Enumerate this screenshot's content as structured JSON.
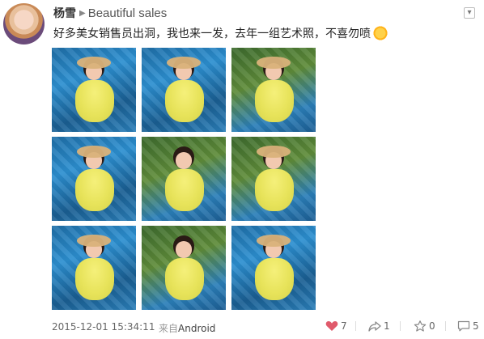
{
  "post": {
    "author": "杨雪",
    "group": "Beautiful sales",
    "text": "好多美女销售员出洞，我也来一发，去年一组艺术照，不喜勿喷",
    "emoji": "sun-icon"
  },
  "photos": [
    {
      "id": 1,
      "alt": "photo-1"
    },
    {
      "id": 2,
      "alt": "photo-2"
    },
    {
      "id": 3,
      "alt": "photo-3"
    },
    {
      "id": 4,
      "alt": "photo-4"
    },
    {
      "id": 5,
      "alt": "photo-5"
    },
    {
      "id": 6,
      "alt": "photo-6"
    },
    {
      "id": 7,
      "alt": "photo-7"
    },
    {
      "id": 8,
      "alt": "photo-8"
    },
    {
      "id": 9,
      "alt": "photo-9"
    }
  ],
  "footer": {
    "timestamp": "2015-12-01 15:34:11",
    "source_prefix": "来自",
    "source_app": "Android",
    "likes": "7",
    "reposts": "1",
    "favorites": "0",
    "comments": "5"
  },
  "colors": {
    "like": "#e05a6b",
    "icon": "#888888"
  }
}
